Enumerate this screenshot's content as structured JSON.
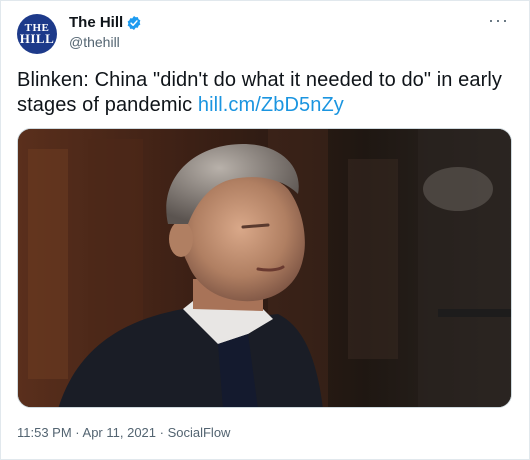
{
  "author": {
    "avatar_text": [
      "THE",
      "HILL"
    ],
    "display_name": "The Hill",
    "handle": "@thehill",
    "verified": true
  },
  "more_icon": "more-dots-icon",
  "tweet": {
    "text": "Blinken: China \"didn't do what it needed to do\" in early stages of pandemic ",
    "link": "hill.cm/ZbD5nZy"
  },
  "media": {
    "alt": "photo"
  },
  "footer": {
    "time": "11:53 PM",
    "separator1": " · ",
    "date": "Apr 11, 2021",
    "separator2": " · ",
    "source": "SocialFlow"
  },
  "colors": {
    "link": "#1b95e0",
    "verified": "#1d9bf0",
    "avatar_bg": "#1d3a8a"
  }
}
